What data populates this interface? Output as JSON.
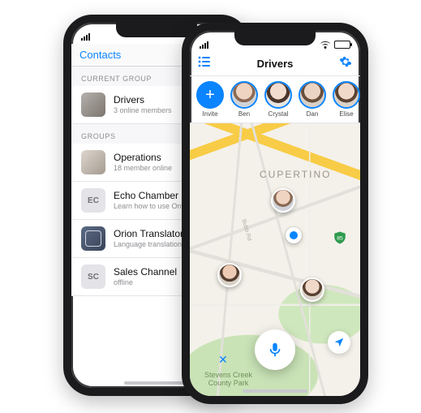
{
  "back": {
    "nav_title": "Contacts",
    "sections": {
      "current": {
        "header": "CURRENT GROUP",
        "item": {
          "title": "Drivers",
          "subtitle": "3 online members"
        }
      },
      "groups": {
        "header": "GROUPS",
        "items": [
          {
            "initials": "",
            "title": "Operations",
            "subtitle": "18 member online"
          },
          {
            "initials": "EC",
            "title": "Echo Chamber",
            "subtitle": "Learn how to use Onyx"
          },
          {
            "initials": "",
            "title": "Orion Translator",
            "subtitle": "Language translation preview"
          },
          {
            "initials": "SC",
            "title": "Sales Channel",
            "subtitle": "offline"
          }
        ]
      }
    }
  },
  "front": {
    "nav_title": "Drivers",
    "invite_label": "Invite",
    "contacts": [
      {
        "name": "Ben"
      },
      {
        "name": "Crystal"
      },
      {
        "name": "Dan"
      },
      {
        "name": "Elise"
      }
    ],
    "map": {
      "city_label": "CUPERTINO",
      "road_label": "Bubb Rd",
      "highway_badge": "85",
      "park_label": "Stevens Creek\nCounty Park",
      "close_glyph": "✕"
    }
  },
  "colors": {
    "accent": "#0a84ff",
    "battery_green": "#34c759"
  }
}
